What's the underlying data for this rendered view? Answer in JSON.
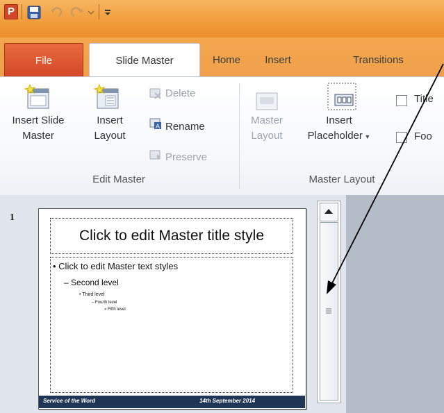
{
  "quick_access": {
    "icons": [
      "powerpoint-logo",
      "save-icon",
      "undo-icon",
      "redo-icon",
      "customize-dropdown-icon"
    ],
    "logo_letter": "P"
  },
  "tabs": {
    "file": "File",
    "slide_master": "Slide Master",
    "home": "Home",
    "insert": "Insert",
    "transitions": "Transitions"
  },
  "ribbon": {
    "edit_master": {
      "label": "Edit Master",
      "insert_slide_master": [
        "Insert Slide",
        "Master"
      ],
      "insert_layout": [
        "Insert",
        "Layout"
      ],
      "delete": "Delete",
      "rename": "Rename",
      "preserve": "Preserve"
    },
    "master_layout": {
      "label": "Master Layout",
      "master_layout_btn": [
        "Master",
        "Layout"
      ],
      "insert_placeholder": [
        "Insert",
        "Placeholder"
      ],
      "title_checkbox": "Title",
      "footers_checkbox": "Foo"
    }
  },
  "thumbnail": {
    "slide_number": "1",
    "title": "Click to edit Master title style",
    "levels": [
      "Click to edit Master text styles",
      "Second level",
      "Third level",
      "Fourth level",
      "Fifth level"
    ],
    "footer_left": "Service of the Word",
    "footer_right": "14th September 2014",
    "footer_color": "#1f3556"
  },
  "colors": {
    "titlebar": "#f19e3c",
    "file_tab": "#d24726",
    "ribbon_bg": "#f6f8fb"
  }
}
